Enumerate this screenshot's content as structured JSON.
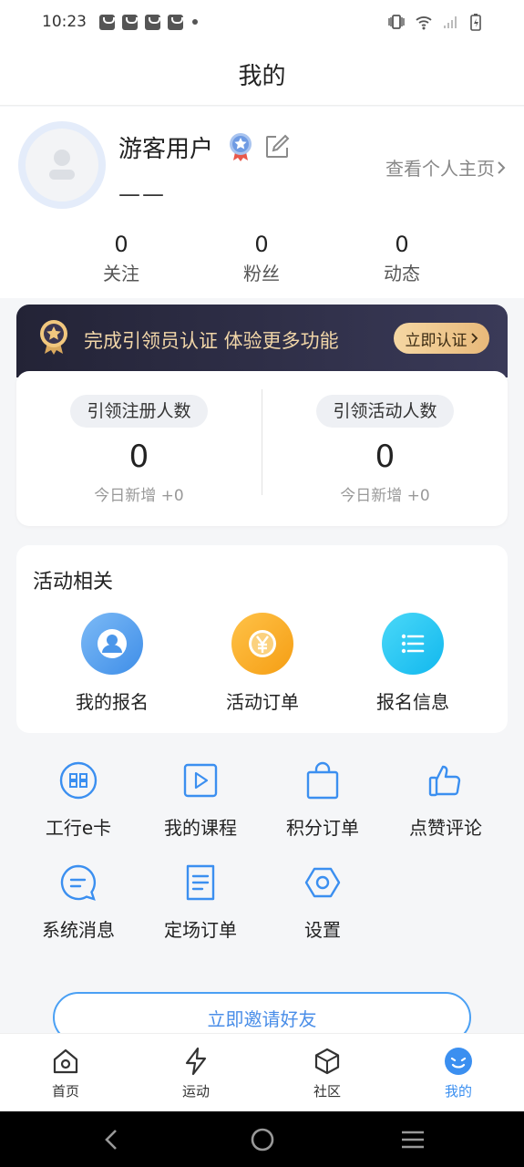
{
  "status_bar": {
    "time": "10:23"
  },
  "header": {
    "title": "我的"
  },
  "profile": {
    "username": "游客用户",
    "subtitle": "——",
    "view_homepage": "查看个人主页",
    "stats": [
      {
        "value": "0",
        "label": "关注"
      },
      {
        "value": "0",
        "label": "粉丝"
      },
      {
        "value": "0",
        "label": "动态"
      }
    ]
  },
  "cert_banner": {
    "text": "完成引领员认证 体验更多功能",
    "button": "立即认证"
  },
  "lead_stats": [
    {
      "title": "引领注册人数",
      "value": "0",
      "sub": "今日新增 +0"
    },
    {
      "title": "引领活动人数",
      "value": "0",
      "sub": "今日新增 +0"
    }
  ],
  "activity": {
    "title": "活动相关",
    "items": [
      {
        "label": "我的报名",
        "icon": "user-icon",
        "color": "#5aa6f0"
      },
      {
        "label": "活动订单",
        "icon": "yen-icon",
        "color": "#f7a625"
      },
      {
        "label": "报名信息",
        "icon": "list-icon",
        "color": "#22c6f2"
      }
    ]
  },
  "grid": [
    {
      "label": "工行e卡",
      "icon": "card-icon"
    },
    {
      "label": "我的课程",
      "icon": "play-icon"
    },
    {
      "label": "积分订单",
      "icon": "bag-icon"
    },
    {
      "label": "点赞评论",
      "icon": "thumb-up-icon"
    },
    {
      "label": "系统消息",
      "icon": "message-icon"
    },
    {
      "label": "定场订单",
      "icon": "document-icon"
    },
    {
      "label": "设置",
      "icon": "settings-icon"
    }
  ],
  "invite": {
    "label": "立即邀请好友"
  },
  "tabbar": [
    {
      "label": "首页",
      "icon": "home-icon"
    },
    {
      "label": "运动",
      "icon": "bolt-icon"
    },
    {
      "label": "社区",
      "icon": "cube-icon"
    },
    {
      "label": "我的",
      "icon": "profile-icon",
      "active": true
    }
  ],
  "colors": {
    "accent": "#3b8ff0",
    "banner": "#2b2b42",
    "gold": "#f1d6a8"
  }
}
